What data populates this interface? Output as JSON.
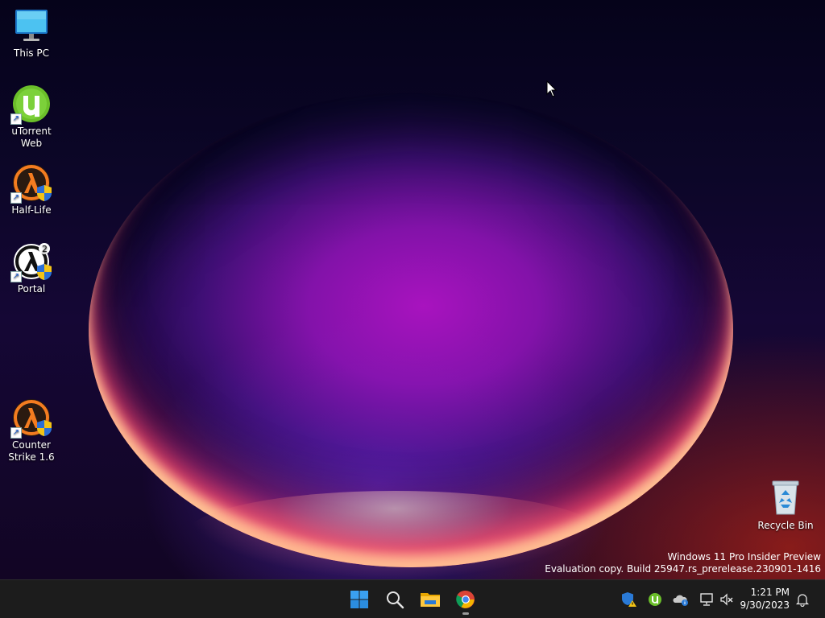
{
  "desktop": {
    "icons": [
      {
        "label": "This PC"
      },
      {
        "label": "uTorrent Web"
      },
      {
        "label": "Half-Life"
      },
      {
        "label": "Portal"
      },
      {
        "label": "Counter Strike 1.6"
      },
      {
        "label": "Recycle Bin"
      }
    ],
    "watermark": {
      "line1": "Windows 11 Pro Insider Preview",
      "line2": "Evaluation copy. Build 25947.rs_prerelease.230901-1416"
    }
  },
  "taskbar": {
    "pinned": [
      {
        "name": "Start",
        "icon": "windows-logo-icon"
      },
      {
        "name": "Search",
        "icon": "search-icon"
      },
      {
        "name": "File Explorer",
        "icon": "folder-icon"
      },
      {
        "name": "Google Chrome",
        "icon": "chrome-icon",
        "running": true
      }
    ],
    "tray": [
      {
        "icon": "security-warning-icon"
      },
      {
        "icon": "utorrent-tray-icon"
      },
      {
        "icon": "onedrive-info-icon"
      },
      {
        "icon": "network-icon"
      },
      {
        "icon": "volume-muted-icon"
      }
    ],
    "clock": {
      "time": "1:21 PM",
      "date": "9/30/2023"
    },
    "notification_icon": "bell-icon"
  },
  "colors": {
    "taskbar_bg": "#1c1c1c",
    "windows_blue": "#3aa0f0",
    "utorrent_green": "#6bbf2a",
    "halflife_orange": "#f47c20"
  }
}
